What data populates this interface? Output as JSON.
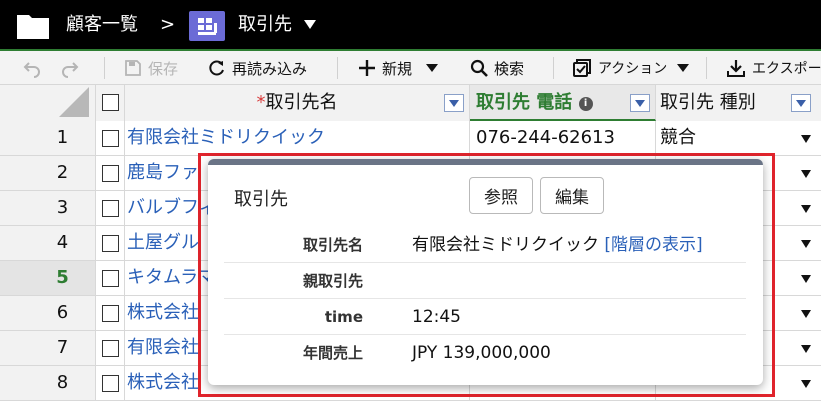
{
  "titlebar": {
    "breadcrumb_parent": "顧客一覧",
    "separator": ">",
    "object_name": "取引先"
  },
  "toolbar": {
    "undo_icon": "undo-icon",
    "redo_icon": "redo-icon",
    "save": "保存",
    "reload": "再読み込み",
    "new": "新規",
    "search": "検索",
    "action": "アクション",
    "export": "エクスポー"
  },
  "columns": {
    "required_mark": "*",
    "name": "取引先名",
    "phone": "取引先 電話",
    "info": "i",
    "type": "取引先 種別"
  },
  "rows": [
    {
      "num": "1",
      "name": "有限会社ミドリクイック",
      "phone": "076-244-62613",
      "type": "競合"
    },
    {
      "num": "2",
      "name": "鹿島ファ",
      "phone": "",
      "type": ""
    },
    {
      "num": "3",
      "name": "バルブフィ",
      "phone": "",
      "type": ""
    },
    {
      "num": "4",
      "name": "土屋グル",
      "phone": "",
      "type": ""
    },
    {
      "num": "5",
      "name": "キタムラマ",
      "phone": "",
      "type": ""
    },
    {
      "num": "6",
      "name": "株式会社",
      "phone": "",
      "type": ""
    },
    {
      "num": "7",
      "name": "有限会社",
      "phone": "",
      "type": ""
    },
    {
      "num": "8",
      "name": "株式会社",
      "phone": "",
      "type": ""
    }
  ],
  "active_row": "5",
  "popover": {
    "title": "取引先",
    "view_button": "参照",
    "edit_button": "編集",
    "fields": [
      {
        "label": "取引先名",
        "value": "有限会社ミドリクイック",
        "link": "[階層の表示]"
      },
      {
        "label": "親取引先",
        "value": "",
        "link": ""
      },
      {
        "label": "time",
        "value": "12:45",
        "link": ""
      },
      {
        "label": "年間売上",
        "value": "JPY 139,000,000",
        "link": ""
      }
    ]
  },
  "colors": {
    "accent_green": "#2e7d32",
    "link_blue": "#2a60b8",
    "highlight_red": "#e0242c",
    "object_icon": "#6b6bd6"
  }
}
